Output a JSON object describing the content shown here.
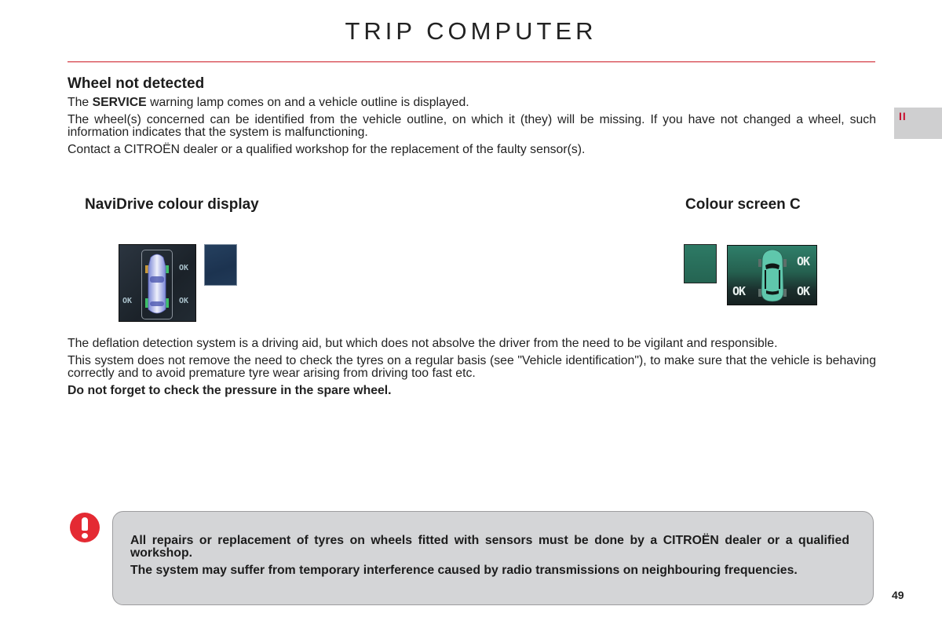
{
  "header": {
    "title": "TRIP COMPUTER",
    "chapter_tab": "II",
    "accent_color": "#c8102e"
  },
  "wheel_not_detected": {
    "heading": "Wheel not detected",
    "p1_prefix": "The ",
    "p1_bold": "SERVICE",
    "p1_suffix": " warning lamp comes on and a vehicle outline is displayed.",
    "p2": "The wheel(s) concerned can be identified from the vehicle outline, on which it (they) will be missing. If you have not changed a wheel, such information indicates that the system is malfunctioning.",
    "p3": "Contact a CITROËN dealer or a qualified workshop for the replacement of the faulty sensor(s)."
  },
  "displays": {
    "navidrive": {
      "label": "NaviDrive colour display",
      "front_right": "OK",
      "rear_left": "OK",
      "rear_right": "OK",
      "missing_wheel": "front-left",
      "swatch_color": "#1f3853"
    },
    "colour_screen_c": {
      "label": "Colour screen C",
      "front_right": "OK",
      "rear_left": "OK",
      "rear_right": "OK",
      "missing_wheel": "front-left",
      "swatch_color": "#2a6f5c"
    }
  },
  "info": {
    "p1": "The deflation detection system is a driving aid, but which does not absolve the driver from the need to be vigilant and responsible.",
    "p2": "This system does not remove the need to check the tyres on a regular basis (see \"Vehicle identification\"), to make sure that the vehicle is behaving correctly and to avoid premature tyre wear arising from driving too fast etc.",
    "p3_bold": "Do not forget to check the pressure in the spare wheel."
  },
  "notice": {
    "icon": "warning-exclamation-icon",
    "p1": "All repairs or replacement of tyres on wheels fitted with sensors must be done by a CITROËN dealer or a qualified workshop.",
    "p2": "The system may suffer from temporary interference caused by radio transmissions on neighbouring frequencies."
  },
  "footer": {
    "page_number": "49"
  }
}
